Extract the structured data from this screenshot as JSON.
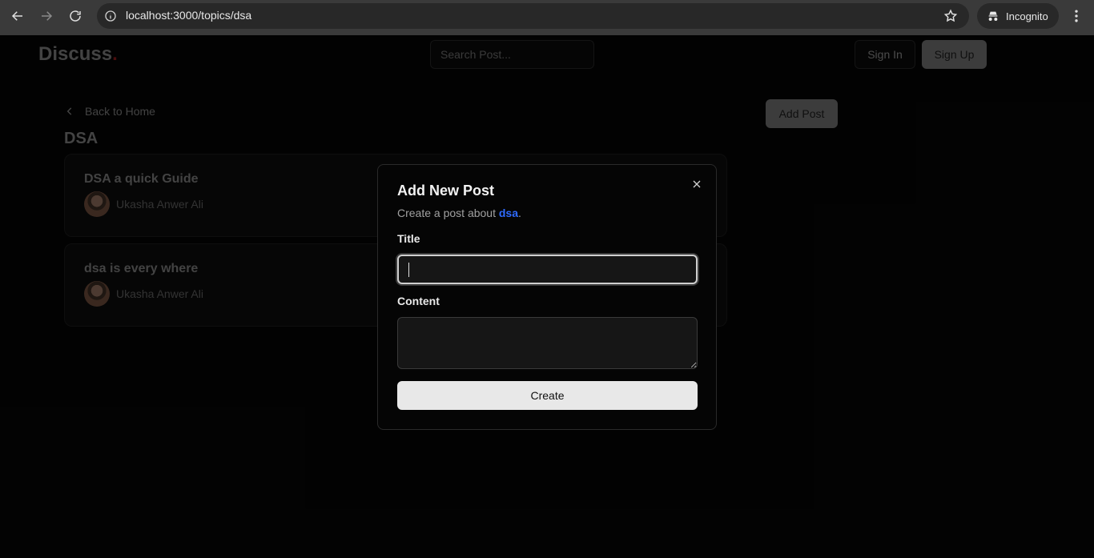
{
  "browser": {
    "url": "localhost:3000/topics/dsa",
    "incognito_label": "Incognito"
  },
  "header": {
    "logo_text": "Discuss",
    "logo_dot": ".",
    "search_placeholder": "Search Post...",
    "sign_in_label": "Sign In",
    "sign_up_label": "Sign Up"
  },
  "page": {
    "back_label": "Back to Home",
    "topic_title": "DSA",
    "add_post_label": "Add Post",
    "posts": [
      {
        "title": "DSA a quick Guide",
        "author": "Ukasha Anwer Ali"
      },
      {
        "title": "dsa is every where",
        "author": "Ukasha Anwer Ali"
      }
    ]
  },
  "modal": {
    "title": "Add New Post",
    "description_prefix": "Create a post about ",
    "topic_slug": "dsa",
    "description_suffix": ".",
    "title_label": "Title",
    "title_value": "",
    "content_label": "Content",
    "content_value": "",
    "create_label": "Create"
  },
  "colors": {
    "background": "#050505",
    "topic_link": "#2f6bff",
    "logo_dot": "#8b1a1a"
  }
}
